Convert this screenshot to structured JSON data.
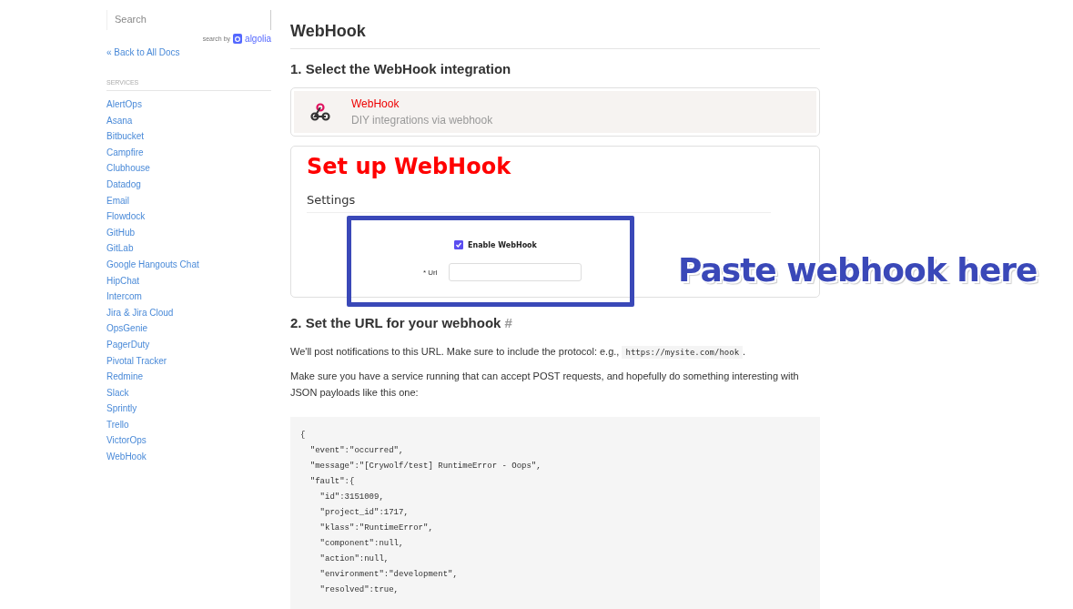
{
  "sidebar": {
    "search": {
      "placeholder": "Search"
    },
    "search_by": {
      "label": "search by",
      "brand": "algolia"
    },
    "back_link": "« Back to All Docs",
    "section": "SERVICES",
    "items": [
      {
        "label": "AlertOps"
      },
      {
        "label": "Asana"
      },
      {
        "label": "Bitbucket"
      },
      {
        "label": "Campfire"
      },
      {
        "label": "Clubhouse"
      },
      {
        "label": "Datadog"
      },
      {
        "label": "Email"
      },
      {
        "label": "Flowdock"
      },
      {
        "label": "GitHub"
      },
      {
        "label": "GitLab"
      },
      {
        "label": "Google Hangouts Chat"
      },
      {
        "label": "HipChat"
      },
      {
        "label": "Intercom"
      },
      {
        "label": "Jira & Jira Cloud"
      },
      {
        "label": "OpsGenie"
      },
      {
        "label": "PagerDuty"
      },
      {
        "label": "Pivotal Tracker"
      },
      {
        "label": "Redmine"
      },
      {
        "label": "Slack"
      },
      {
        "label": "Sprintly"
      },
      {
        "label": "Trello"
      },
      {
        "label": "VictorOps"
      },
      {
        "label": "WebHook"
      }
    ]
  },
  "page": {
    "title": "WebHook",
    "step1": "1. Select the WebHook integration",
    "integration": {
      "name": "WebHook",
      "description": "DIY integrations via webhook"
    },
    "setup": {
      "title": "Set up WebHook",
      "settings": "Settings",
      "enable": {
        "label": "Enable WebHook",
        "checked": true
      },
      "url_label": "* Url"
    },
    "annotation": "Paste webhook here",
    "step2": "2. Set the URL for your webhook",
    "anchor": "#",
    "para1": "We'll post notifications to this URL. Make sure to include the protocol: e.g.,",
    "para1_code": "https://mysite.com/hook",
    "para1_end": ".",
    "para2": "Make sure you have a service running that can accept POST requests, and hopefully do something interesting with JSON payloads like this one:",
    "code": [
      "{",
      "  \"event\":\"occurred\",",
      "  \"message\":\"[Crywolf/test] RuntimeError - Oops\",",
      "  \"fault\":{",
      "    \"id\":3151009,",
      "    \"project_id\":1717,",
      "    \"klass\":\"RuntimeError\",",
      "    \"component\":null,",
      "    \"action\":null,",
      "    \"environment\":\"development\",",
      "    \"resolved\":true,"
    ]
  }
}
